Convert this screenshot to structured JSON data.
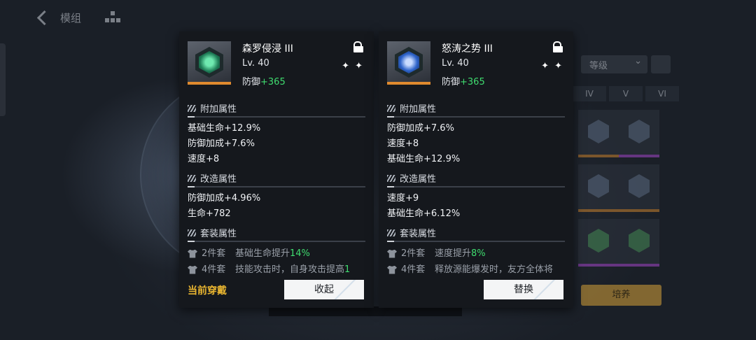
{
  "topbar": {
    "title": "模组"
  },
  "inventory": {
    "sort_label": "等级",
    "tiers": [
      "IV",
      "V",
      "VI"
    ],
    "cultivate_label": "培养"
  },
  "cards": [
    {
      "name": "森罗侵浸 III",
      "level": "Lv. 40",
      "main_stat_label": "防御",
      "main_stat_value": "+365",
      "stars": "✦ ✦",
      "extra_title": "附加属性",
      "extra_stats": [
        "基础生命+12.9%",
        "防御加成+7.6%",
        "速度+8"
      ],
      "mod_title": "改造属性",
      "mod_stats": [
        "防御加成+4.96%",
        "生命+782"
      ],
      "set_title": "套装属性",
      "set_bonuses": [
        {
          "pieces": "2件套",
          "desc": "基础生命提升",
          "value": "14%"
        },
        {
          "pieces": "4件套",
          "desc": "技能攻击时，自身攻击提高",
          "value": "1"
        }
      ],
      "footer_status": "当前穿戴",
      "action_label": "收起"
    },
    {
      "name": "怒涛之势 III",
      "level": "Lv. 40",
      "main_stat_label": "防御",
      "main_stat_value": "+365",
      "stars": "✦ ✦",
      "extra_title": "附加属性",
      "extra_stats": [
        "防御加成+7.6%",
        "速度+8",
        "基础生命+12.9%"
      ],
      "mod_title": "改造属性",
      "mod_stats": [
        "速度+9",
        "基础生命+6.12%"
      ],
      "set_title": "套装属性",
      "set_bonuses": [
        {
          "pieces": "2件套",
          "desc": "速度提升",
          "value": "8%"
        },
        {
          "pieces": "4件套",
          "desc": "释放源能爆发时，友方全体将",
          "value": ""
        }
      ],
      "footer_status": "",
      "action_label": "替换"
    }
  ],
  "colors": {
    "accent_green": "#3fdc6f",
    "equipped_gold": "#e9b530",
    "rarity_orange": "#e08a2e"
  }
}
